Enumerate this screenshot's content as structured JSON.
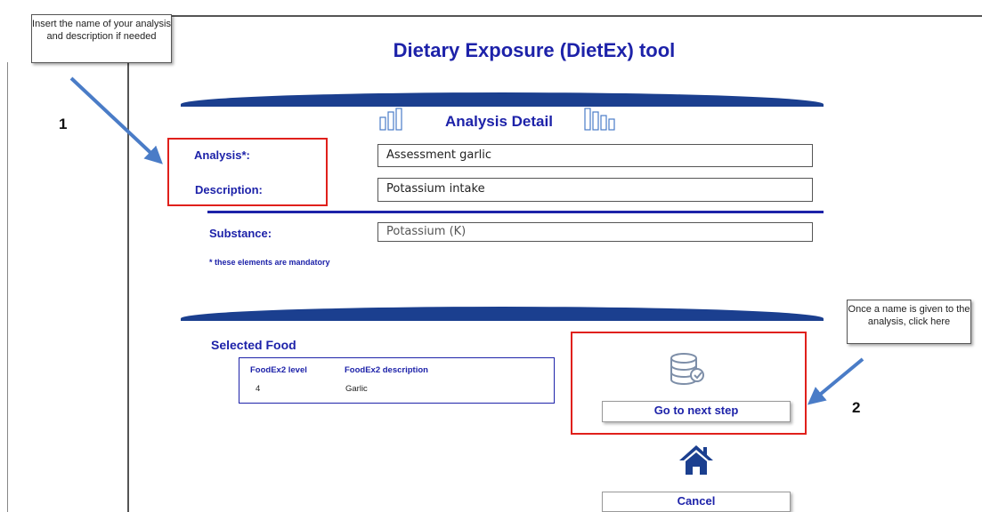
{
  "app": {
    "title": "Dietary Exposure (DietEx) tool"
  },
  "analysis_detail": {
    "title": "Analysis Detail",
    "analysis_label": "Analysis*:",
    "analysis_value": "Assessment garlic",
    "description_label": "Description:",
    "description_value": "Potassium intake",
    "substance_label": "Substance:",
    "substance_value": "Potassium (K)",
    "mandatory_note": "* these elements are mandatory"
  },
  "selected_food": {
    "title": "Selected Food",
    "columns": [
      "FoodEx2 level",
      "FoodEx2 description"
    ],
    "rows": [
      [
        "4",
        "Garlic"
      ]
    ]
  },
  "actions": {
    "next_label": "Go to next step",
    "cancel_label": "Cancel"
  },
  "annotations": {
    "callout_1": "Insert the name of your analysis and description if needed",
    "callout_2": "Once a name is given to the analysis, click here",
    "step_1": "1",
    "step_2": "2"
  },
  "icons": {
    "analysis_left": "bar-chart-icon",
    "analysis_right": "bar-chart-icon",
    "database": "database-icon",
    "home": "home-icon"
  },
  "colors": {
    "accent_blue": "#1d22a9",
    "band_blue": "#1b3f8f",
    "highlight_red": "#e0201b",
    "arrow_blue": "#4a7cc7"
  }
}
